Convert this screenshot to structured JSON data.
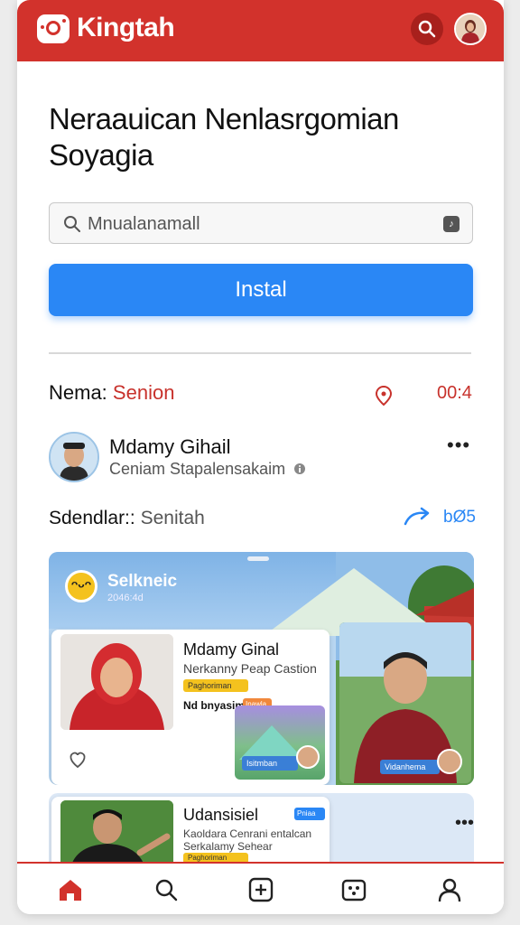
{
  "app": {
    "title": "Kingtah",
    "brand_color": "#d2322c",
    "accent_color": "#2a87f5"
  },
  "header": {
    "headline": "Neraauican Nenlasrgomian Soyagia"
  },
  "search": {
    "value": "Mnualanamall"
  },
  "install_button": {
    "label": "Instal"
  },
  "info": {
    "name_label": "Nema:",
    "name_value": "Senion",
    "count": "00:4",
    "schedule_label": "Sdendlar::",
    "schedule_value": "Senitah",
    "share_count": "bØ5"
  },
  "profile": {
    "name": "Mdamy Gihail",
    "subtitle": "Ceniam Stapalensakaim"
  },
  "feed_card": {
    "title": "Selkneic",
    "subtitle": "2046:4d",
    "inner": {
      "name": "Mdamy Ginal",
      "subtitle": "Nerkanny Peap Castion",
      "tag": "Paghoriman",
      "date": "Nd bnyasim",
      "tag2": "Inawla"
    },
    "thumb_label": "Isitmban",
    "right_label": "Vidanhema"
  },
  "card2": {
    "name": "Udansisiel",
    "badge": "Pniaa",
    "line1": "Kaoldara Cenrani entalcan",
    "line2": "Serkalamy Sehear",
    "tag": "Paghoriman"
  },
  "nav": [
    "home-icon",
    "search-icon",
    "add-icon",
    "gallery-icon",
    "profile-icon"
  ]
}
